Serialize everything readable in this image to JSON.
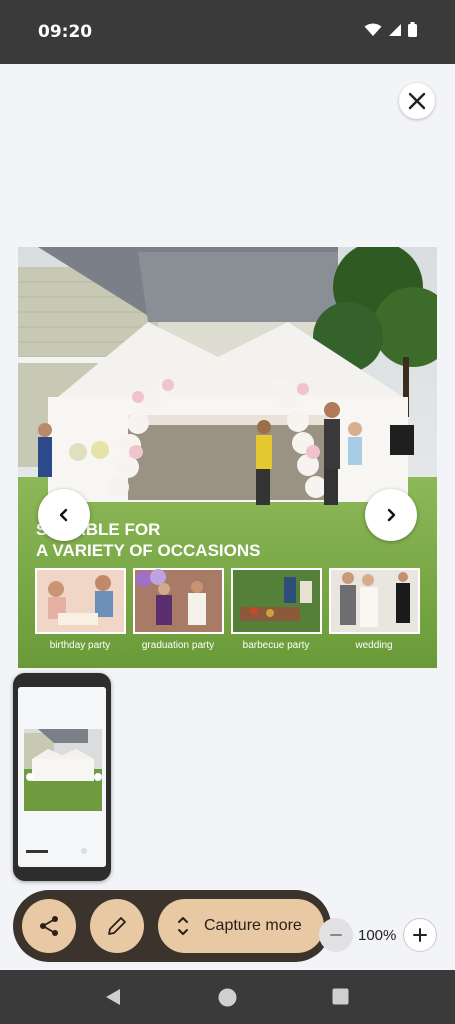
{
  "status_bar": {
    "time": "09:20",
    "icons": [
      "wifi-icon",
      "signal-icon",
      "battery-icon"
    ]
  },
  "viewer": {
    "close_icon": "close-icon",
    "prev_icon": "chevron-left-icon",
    "next_icon": "chevron-right-icon"
  },
  "product_image": {
    "headline_line1": "SUITABLE FOR",
    "headline_line2": "A VARIETY OF OCCASIONS",
    "occasions": [
      {
        "label": "birthday party"
      },
      {
        "label": "graduation party"
      },
      {
        "label": "barbecue party"
      },
      {
        "label": "wedding"
      }
    ]
  },
  "toolbar": {
    "share_icon": "share-icon",
    "edit_icon": "pencil-icon",
    "capture_label": "Capture more"
  },
  "zoom": {
    "level": "100%"
  },
  "colors": {
    "status_bar": "#3a3a3a",
    "toolbar_bg": "#3b332c",
    "toolbar_button": "#e8c9a3",
    "background": "#f3f4f7"
  }
}
